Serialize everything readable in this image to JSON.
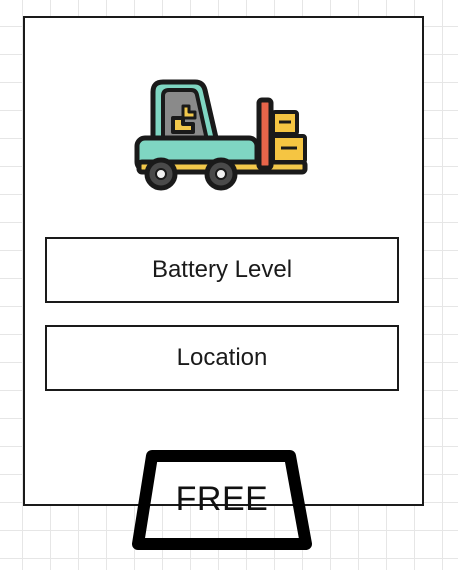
{
  "vehicle_card": {
    "icon": "forklift-icon",
    "fields": {
      "battery_label": "Battery Level",
      "location_label": "Location"
    }
  },
  "status_tag": {
    "label": "FREE"
  },
  "colors": {
    "outline": "#1a1a1a",
    "forklift_body": "#7fd6c2",
    "forklift_seat": "#f2c84b",
    "forklift_cabin": "#8a8a8a",
    "forklift_mast": "#e8654a",
    "forklift_box": "#f5c542"
  }
}
